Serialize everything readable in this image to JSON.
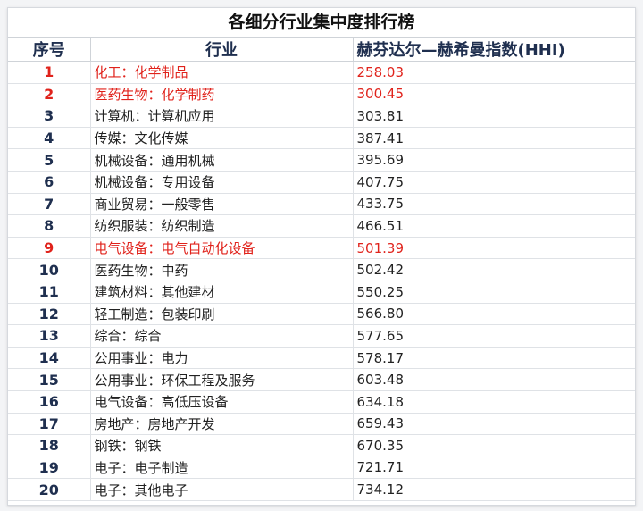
{
  "title": "各细分行业集中度排行榜",
  "headers": {
    "rank": "序号",
    "industry": "行业",
    "hhi": "赫芬达尔—赫希曼指数(HHI)"
  },
  "highlight_color": "#e0221b",
  "header_color": "#1f2f4f",
  "rows": [
    {
      "rank": "1",
      "industry": "化工：化学制品",
      "hhi": "258.03",
      "highlight": true
    },
    {
      "rank": "2",
      "industry": "医药生物：化学制药",
      "hhi": "300.45",
      "highlight": true
    },
    {
      "rank": "3",
      "industry": "计算机：计算机应用",
      "hhi": "303.81",
      "highlight": false
    },
    {
      "rank": "4",
      "industry": "传媒：文化传媒",
      "hhi": "387.41",
      "highlight": false
    },
    {
      "rank": "5",
      "industry": "机械设备：通用机械",
      "hhi": "395.69",
      "highlight": false
    },
    {
      "rank": "6",
      "industry": "机械设备：专用设备",
      "hhi": "407.75",
      "highlight": false
    },
    {
      "rank": "7",
      "industry": "商业贸易：一般零售",
      "hhi": "433.75",
      "highlight": false
    },
    {
      "rank": "8",
      "industry": "纺织服装：纺织制造",
      "hhi": "466.51",
      "highlight": false
    },
    {
      "rank": "9",
      "industry": "电气设备：电气自动化设备",
      "hhi": "501.39",
      "highlight": true
    },
    {
      "rank": "10",
      "industry": "医药生物：中药",
      "hhi": "502.42",
      "highlight": false
    },
    {
      "rank": "11",
      "industry": "建筑材料：其他建材",
      "hhi": "550.25",
      "highlight": false
    },
    {
      "rank": "12",
      "industry": "轻工制造：包装印刷",
      "hhi": "566.80",
      "highlight": false
    },
    {
      "rank": "13",
      "industry": "综合：综合",
      "hhi": "577.65",
      "highlight": false
    },
    {
      "rank": "14",
      "industry": "公用事业：电力",
      "hhi": "578.17",
      "highlight": false
    },
    {
      "rank": "15",
      "industry": "公用事业：环保工程及服务",
      "hhi": "603.48",
      "highlight": false
    },
    {
      "rank": "16",
      "industry": "电气设备：高低压设备",
      "hhi": "634.18",
      "highlight": false
    },
    {
      "rank": "17",
      "industry": "房地产：房地产开发",
      "hhi": "659.43",
      "highlight": false
    },
    {
      "rank": "18",
      "industry": "钢铁：钢铁",
      "hhi": "670.35",
      "highlight": false
    },
    {
      "rank": "19",
      "industry": "电子：电子制造",
      "hhi": "721.71",
      "highlight": false
    },
    {
      "rank": "20",
      "industry": "电子：其他电子",
      "hhi": "734.12",
      "highlight": false
    }
  ]
}
